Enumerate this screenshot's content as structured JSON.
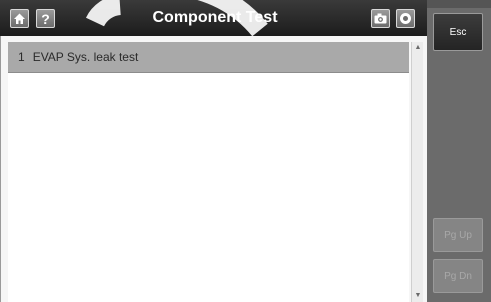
{
  "title_bar": {
    "title": "Component Test",
    "help_label": "?",
    "icons": [
      "home-icon",
      "help-icon",
      "camera-icon",
      "record-icon"
    ]
  },
  "list": {
    "items": [
      {
        "number": "1",
        "label": "EVAP Sys. leak test",
        "selected": true
      }
    ]
  },
  "side_buttons": {
    "esc": "Esc",
    "page_up": "Pg Up",
    "page_down": "Pg Dn"
  },
  "colors": {
    "title_bar": "#2a2a2a",
    "selected_row": "#a9a9a9",
    "side_panel": "#6b6b6b",
    "watermark": "#ffffff"
  }
}
